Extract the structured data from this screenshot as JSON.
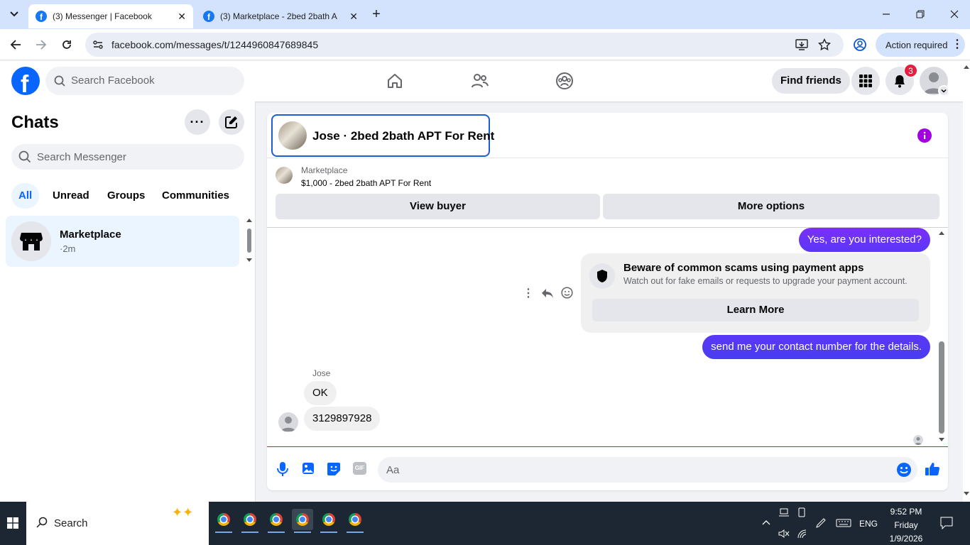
{
  "browser": {
    "tabs": [
      {
        "title": "(3) Messenger | Facebook"
      },
      {
        "title": "(3) Marketplace - 2bed 2bath A"
      }
    ],
    "url": "facebook.com/messages/t/1244960847689845",
    "action_required": "Action required"
  },
  "fb_header": {
    "logo_letter": "f",
    "search_placeholder": "Search Facebook",
    "find_friends": "Find friends",
    "notification_count": "3"
  },
  "chats": {
    "title": "Chats",
    "search_placeholder": "Search Messenger",
    "filters": [
      "All",
      "Unread",
      "Groups",
      "Communities"
    ],
    "items": [
      {
        "name": "Marketplace",
        "meta": "·2m"
      }
    ]
  },
  "conversation": {
    "title": "Jose · 2bed 2bath APT For Rent",
    "listing": {
      "source": "Marketplace",
      "summary": "$1,000 - 2bed 2bath APT For Rent"
    },
    "buttons": {
      "view_buyer": "View buyer",
      "more_options": "More options"
    },
    "messages": {
      "out1": "Yes, are you interested?",
      "scam_title": "Beware of common scams using payment apps",
      "scam_body": "Watch out for fake emails or requests to upgrade your payment account.",
      "learn_more": "Learn More",
      "out2": "send me your contact number for the details.",
      "sender_name": "Jose",
      "in1": "OK",
      "in2": "3129897928"
    },
    "composer_placeholder": "Aa"
  },
  "taskbar": {
    "search_label": "Search",
    "language": "ENG",
    "time": "9:52 PM",
    "day": "Friday",
    "date": "1/9/2026"
  },
  "colors": {
    "fb_blue": "#0866ff",
    "messenger_purple": "#7b2ff7",
    "info_purple": "#a200e0",
    "badge_red": "#e41e3f"
  }
}
